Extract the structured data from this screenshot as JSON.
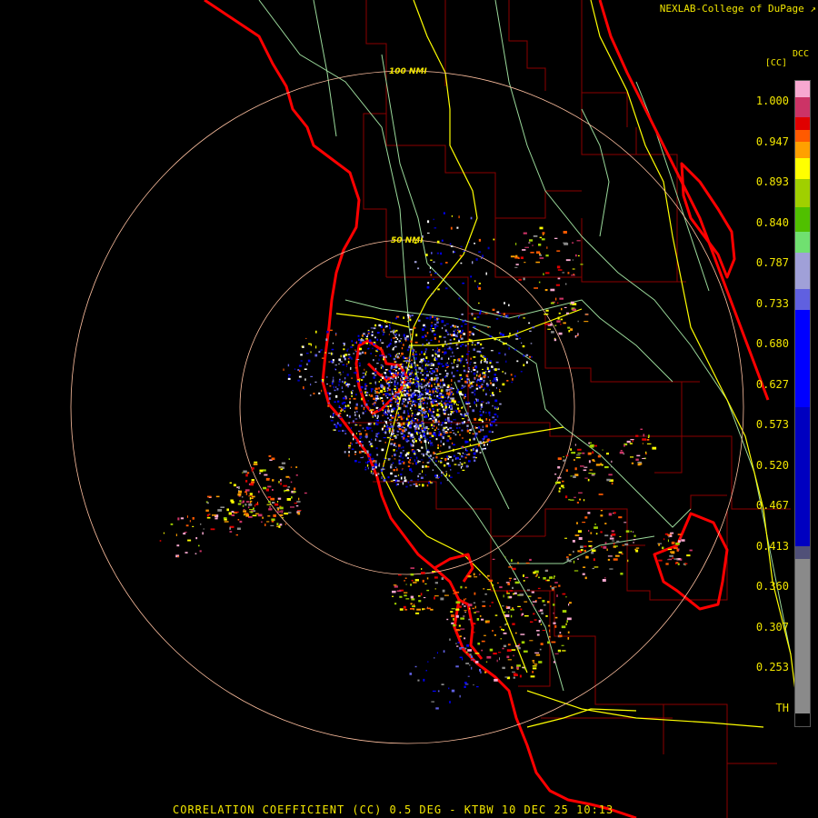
{
  "credit": "NEXLAB-College of DuPage",
  "product_line": "CORRELATION COEFFICIENT (CC) 0.5 DEG - KTBW 10 DEC 25 10:13",
  "legend": {
    "product": "DCC",
    "unit": "[CC]",
    "ticks": [
      "1.000",
      "0.947",
      "0.893",
      "0.840",
      "0.787",
      "0.733",
      "0.680",
      "0.627",
      "0.573",
      "0.520",
      "0.467",
      "0.413",
      "0.360",
      "0.307",
      "0.253",
      "TH"
    ],
    "color_bands": [
      {
        "from": 1.0,
        "to": 0.98,
        "color": "#f7a8d0"
      },
      {
        "from": 0.98,
        "to": 0.955,
        "color": "#cc3366"
      },
      {
        "from": 0.955,
        "to": 0.94,
        "color": "#e00000"
      },
      {
        "from": 0.94,
        "to": 0.925,
        "color": "#ff5a00"
      },
      {
        "from": 0.925,
        "to": 0.905,
        "color": "#ffa000"
      },
      {
        "from": 0.905,
        "to": 0.88,
        "color": "#ffff00"
      },
      {
        "from": 0.88,
        "to": 0.845,
        "color": "#a0d000"
      },
      {
        "from": 0.845,
        "to": 0.815,
        "color": "#50c000"
      },
      {
        "from": 0.815,
        "to": 0.79,
        "color": "#70e070"
      },
      {
        "from": 0.79,
        "to": 0.745,
        "color": "#a0a0d8"
      },
      {
        "from": 0.745,
        "to": 0.72,
        "color": "#6060e0"
      },
      {
        "from": 0.72,
        "to": 0.6,
        "color": "#0000ff"
      },
      {
        "from": 0.6,
        "to": 0.43,
        "color": "#0000c0"
      },
      {
        "from": 0.43,
        "to": 0.415,
        "color": "#505078"
      },
      {
        "from": 0.415,
        "to": 0.225,
        "color": "#8a8a8a"
      },
      {
        "from": 0.225,
        "to": 0.21,
        "color": "#000000"
      }
    ]
  },
  "range_rings": [
    {
      "label": "50 NMI",
      "radius_nmi": 50
    },
    {
      "label": "100 NMI",
      "radius_nmi": 100
    }
  ],
  "colors": {
    "text": "#f2e600",
    "range_ring": "#ffc0a0",
    "coastline": "#ff0000",
    "county_lines": "#8b0000",
    "highways": "#ffff00",
    "roads": "#9ad89a"
  }
}
